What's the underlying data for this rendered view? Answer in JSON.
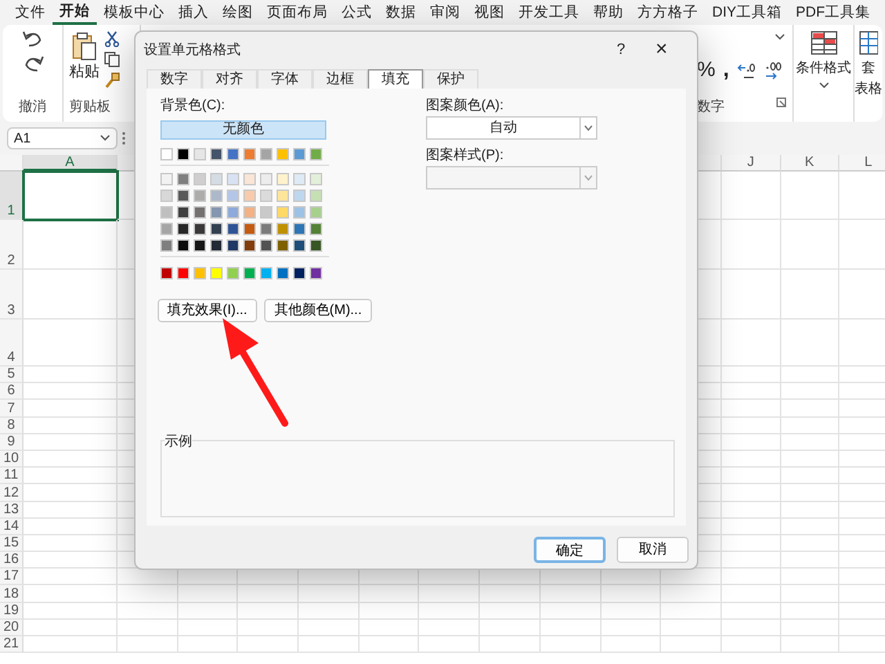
{
  "menu_tabs": [
    {
      "label": "文件",
      "selected": false
    },
    {
      "label": "开始",
      "selected": true
    },
    {
      "label": "模板中心",
      "selected": false
    },
    {
      "label": "插入",
      "selected": false
    },
    {
      "label": "绘图",
      "selected": false
    },
    {
      "label": "页面布局",
      "selected": false
    },
    {
      "label": "公式",
      "selected": false
    },
    {
      "label": "数据",
      "selected": false
    },
    {
      "label": "审阅",
      "selected": false
    },
    {
      "label": "视图",
      "selected": false
    },
    {
      "label": "开发工具",
      "selected": false
    },
    {
      "label": "帮助",
      "selected": false
    },
    {
      "label": "方方格子",
      "selected": false
    },
    {
      "label": "DIY工具箱",
      "selected": false
    },
    {
      "label": "PDF工具集",
      "selected": false
    }
  ],
  "ribbon": {
    "undo_group_label": "撤消",
    "paste_label": "粘贴",
    "clipboard_group_label": "剪贴板",
    "percent_symbol": "%",
    "comma_symbol": ",",
    "number_group_label": "数字",
    "conditional_format_label": "条件格式",
    "table_format_label_top": "套",
    "table_format_label_bottom": "表格"
  },
  "name_box": "A1",
  "column_headers": [
    {
      "label": "A",
      "selected": true
    },
    {
      "label": "J",
      "selected": false
    },
    {
      "label": "K",
      "selected": false
    },
    {
      "label": "L",
      "selected": false
    }
  ],
  "row_headers": [
    {
      "label": "1",
      "selected": true
    },
    {
      "label": "2",
      "selected": false
    },
    {
      "label": "3",
      "selected": false
    },
    {
      "label": "4",
      "selected": false
    },
    {
      "label": "5",
      "selected": false
    },
    {
      "label": "6",
      "selected": false
    },
    {
      "label": "7",
      "selected": false
    },
    {
      "label": "8",
      "selected": false
    },
    {
      "label": "9",
      "selected": false
    },
    {
      "label": "10",
      "selected": false
    },
    {
      "label": "11",
      "selected": false
    },
    {
      "label": "12",
      "selected": false
    },
    {
      "label": "13",
      "selected": false
    },
    {
      "label": "14",
      "selected": false
    },
    {
      "label": "15",
      "selected": false
    },
    {
      "label": "16",
      "selected": false
    },
    {
      "label": "17",
      "selected": false
    },
    {
      "label": "18",
      "selected": false
    },
    {
      "label": "19",
      "selected": false
    },
    {
      "label": "20",
      "selected": false
    },
    {
      "label": "21",
      "selected": false
    }
  ],
  "dialog": {
    "title": "设置单元格格式",
    "help_label": "?",
    "close_label": "×",
    "tabs": [
      {
        "label": "数字",
        "selected": false
      },
      {
        "label": "对齐",
        "selected": false
      },
      {
        "label": "字体",
        "selected": false
      },
      {
        "label": "边框",
        "selected": false
      },
      {
        "label": "填充",
        "selected": true
      },
      {
        "label": "保护",
        "selected": false
      }
    ],
    "background_label": "背景色(C):",
    "no_color_button": {
      "label": "无颜色",
      "selected": true
    },
    "theme_colors": [
      {
        "color": "#ffffff"
      },
      {
        "color": "#000000"
      },
      {
        "color": "#e7e6e6"
      },
      {
        "color": "#44546a"
      },
      {
        "color": "#4472c4"
      },
      {
        "color": "#ed7d31"
      },
      {
        "color": "#a5a5a5"
      },
      {
        "color": "#ffc000"
      },
      {
        "color": "#5b9bd5"
      },
      {
        "color": "#70ad47"
      }
    ],
    "tint_rows": [
      [
        {
          "color": "#f2f2f2"
        },
        {
          "color": "#7f7f7f"
        },
        {
          "color": "#d0cece"
        },
        {
          "color": "#d6dce4"
        },
        {
          "color": "#d9e2f3"
        },
        {
          "color": "#fbe5d5"
        },
        {
          "color": "#ededed"
        },
        {
          "color": "#fff2cc"
        },
        {
          "color": "#deebf6"
        },
        {
          "color": "#e2efd9"
        }
      ],
      [
        {
          "color": "#d8d8d8"
        },
        {
          "color": "#595959"
        },
        {
          "color": "#aeabab"
        },
        {
          "color": "#adb9ca"
        },
        {
          "color": "#b4c6e7"
        },
        {
          "color": "#f7cbac"
        },
        {
          "color": "#dbdbdb"
        },
        {
          "color": "#fee599"
        },
        {
          "color": "#bdd7ee"
        },
        {
          "color": "#c5e0b3"
        }
      ],
      [
        {
          "color": "#bfbfbf"
        },
        {
          "color": "#3f3f3f"
        },
        {
          "color": "#757070"
        },
        {
          "color": "#8496b0"
        },
        {
          "color": "#8eaadb"
        },
        {
          "color": "#f4b183"
        },
        {
          "color": "#c9c9c9"
        },
        {
          "color": "#ffd965"
        },
        {
          "color": "#9cc3e5"
        },
        {
          "color": "#a8d08d"
        }
      ],
      [
        {
          "color": "#a5a5a5"
        },
        {
          "color": "#262626"
        },
        {
          "color": "#3a3838"
        },
        {
          "color": "#323f4f"
        },
        {
          "color": "#2f5496"
        },
        {
          "color": "#c55a11"
        },
        {
          "color": "#7b7b7b"
        },
        {
          "color": "#bf9000"
        },
        {
          "color": "#2e75b5"
        },
        {
          "color": "#538135"
        }
      ],
      [
        {
          "color": "#7f7f7f"
        },
        {
          "color": "#0c0c0c"
        },
        {
          "color": "#171616"
        },
        {
          "color": "#222a35"
        },
        {
          "color": "#1f3864"
        },
        {
          "color": "#833c0b"
        },
        {
          "color": "#525252"
        },
        {
          "color": "#7f6000"
        },
        {
          "color": "#1e4e79"
        },
        {
          "color": "#375623"
        }
      ]
    ],
    "standard_colors": [
      {
        "color": "#c00000"
      },
      {
        "color": "#ff0000"
      },
      {
        "color": "#ffc000"
      },
      {
        "color": "#ffff00"
      },
      {
        "color": "#92d050"
      },
      {
        "color": "#00b050"
      },
      {
        "color": "#00b0f0"
      },
      {
        "color": "#0070c0"
      },
      {
        "color": "#002060"
      },
      {
        "color": "#7030a0"
      }
    ],
    "fill_effects_button": "填充效果(I)...",
    "more_colors_button": "其他颜色(M)...",
    "pattern_color_label": "图案颜色(A):",
    "pattern_color_value": "自动",
    "pattern_style_label": "图案样式(P):",
    "pattern_style_disabled": true,
    "sample_label": "示例",
    "ok_button": {
      "label": "确定",
      "selected": true
    },
    "cancel_button": {
      "label": "取消",
      "selected": false
    }
  }
}
